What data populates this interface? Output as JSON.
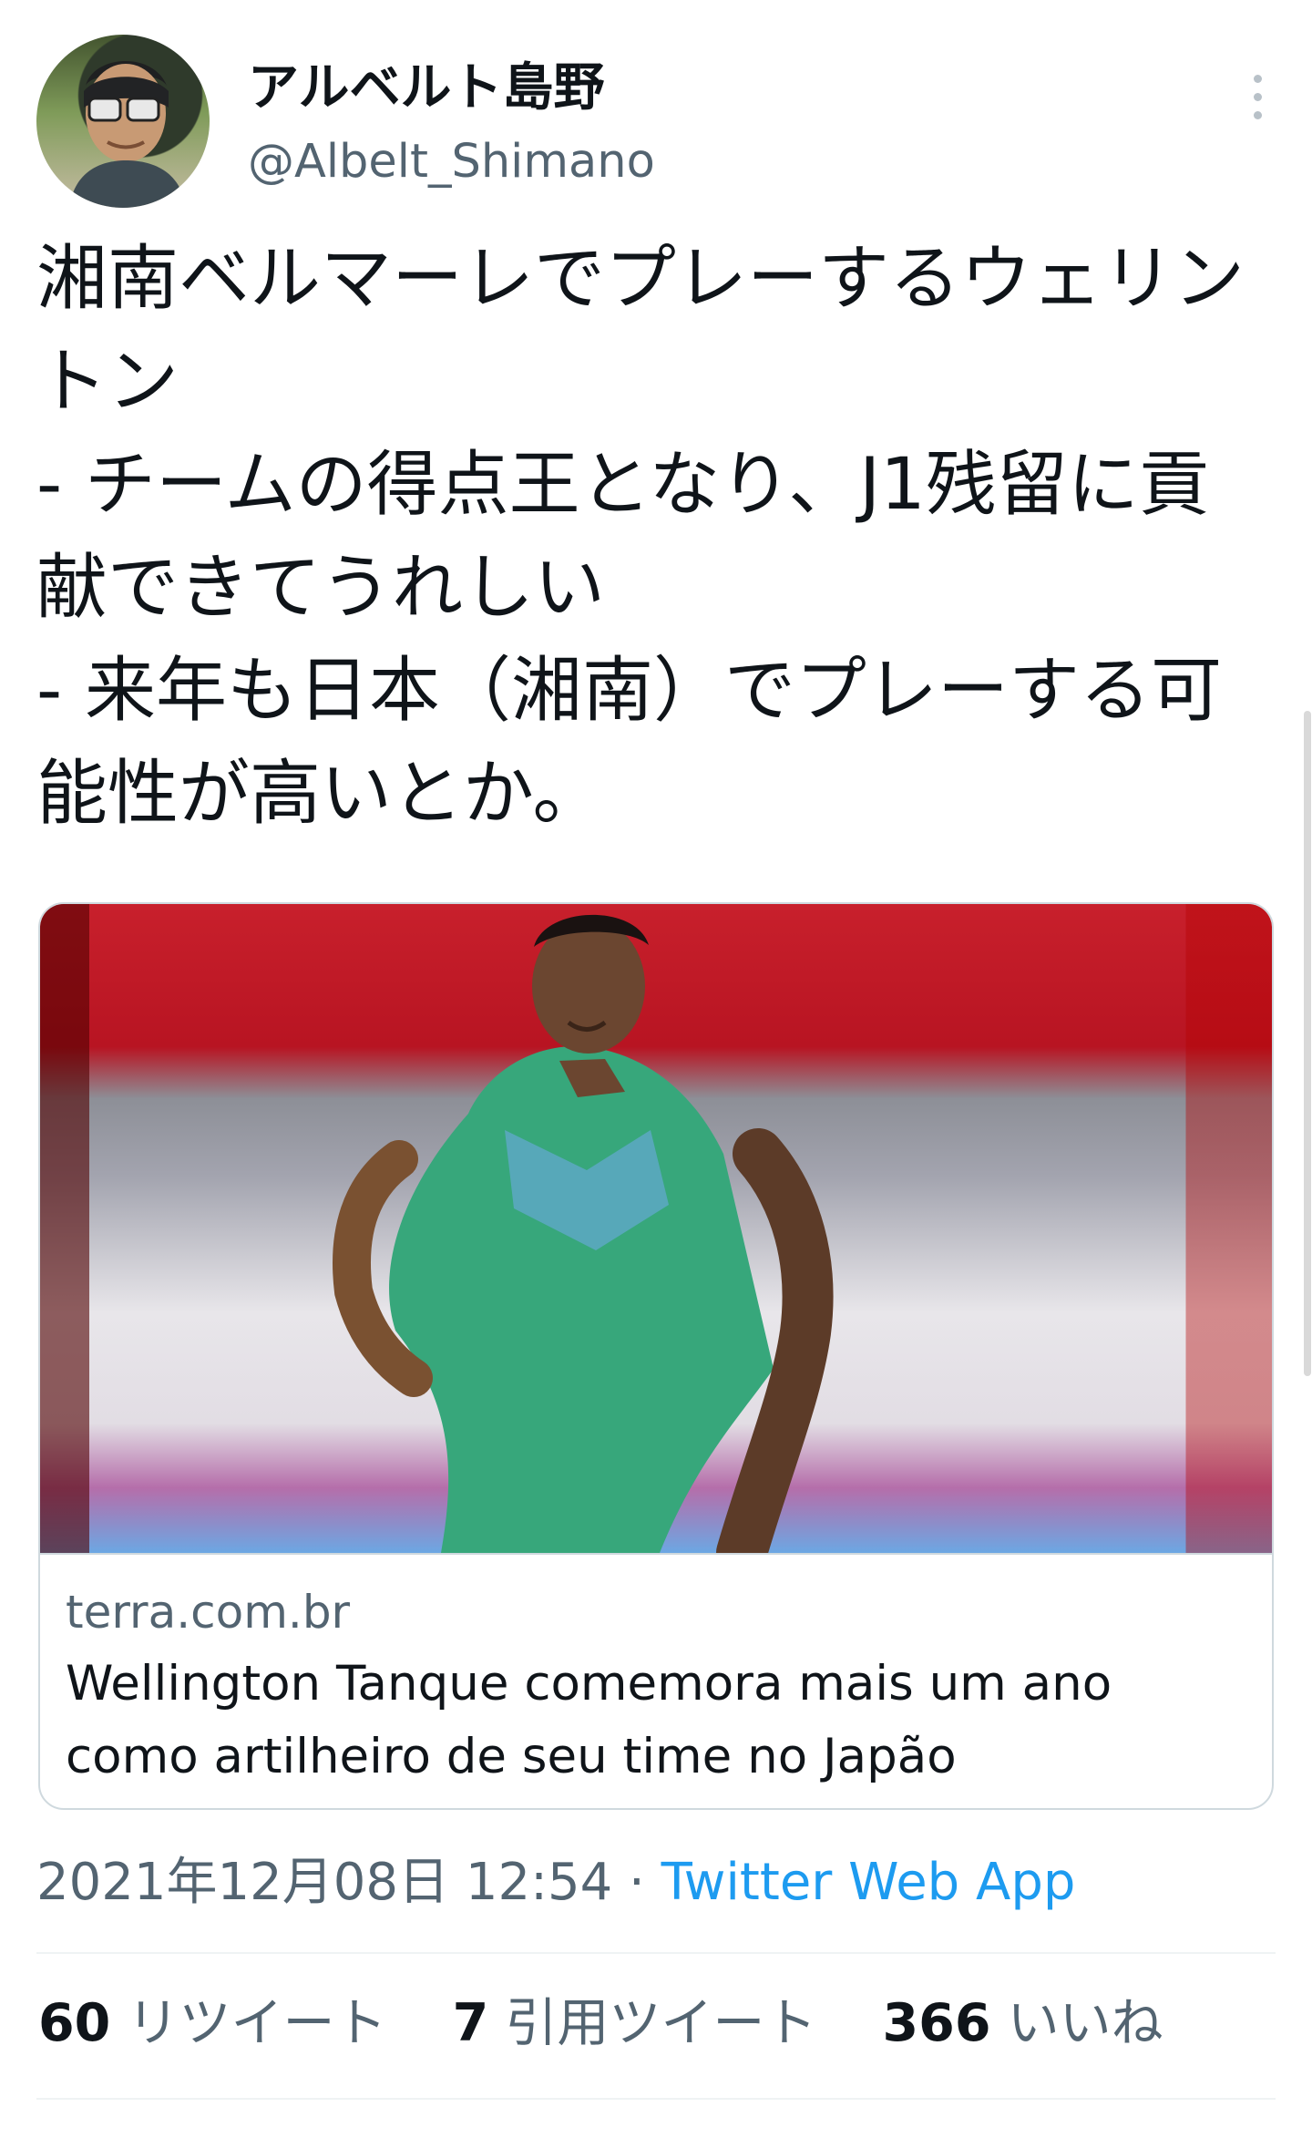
{
  "profile": {
    "name": "アルベルト島野",
    "handle": "@Albelt_Shimano"
  },
  "tweet": {
    "text": "湘南ベルマーレでプレーするウェリントン\n- チームの得点王となり、J1残留に貢献できてうれしい\n- 来年も日本（湘南）でプレーする可能性が高いとか。"
  },
  "card": {
    "domain": "terra.com.br",
    "title": "Wellington Tanque comemora mais um ano como artilheiro de seu time no Japão"
  },
  "meta": {
    "timestamp": "2021年12月08日 12:54 · ",
    "source": "Twitter Web App"
  },
  "stats": {
    "retweets": "60",
    "retweets_label": "リツイート",
    "quotes": "7",
    "quotes_label": "引用ツイート",
    "likes": "366",
    "likes_label": "いいね"
  },
  "icons": {
    "more": "more-options-icon"
  },
  "colors": {
    "link": "#1d9bf0",
    "text": "#0f1419",
    "muted": "#536471",
    "border": "#cfd9de"
  }
}
